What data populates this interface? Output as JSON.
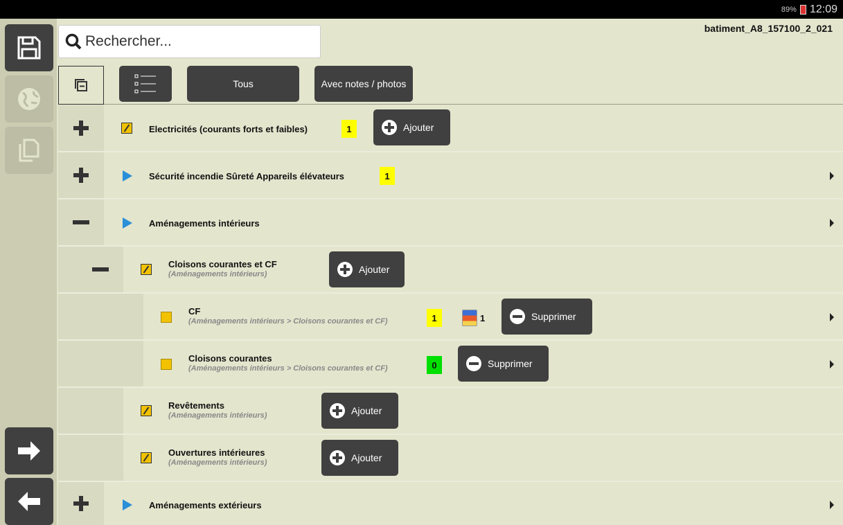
{
  "status": {
    "battery": "89%",
    "time": "12:09"
  },
  "file": {
    "name": "batiment_A8_157100_2_021"
  },
  "search": {
    "placeholder": "Rechercher..."
  },
  "toolbar": {
    "all_label": "Tous",
    "notes_label": "Avec notes / photos"
  },
  "rows": [
    {
      "label": "Electricités (courants forts et faibles)",
      "count": "1",
      "add": "Ajouter"
    },
    {
      "label": "Sécurité incendie Sûreté Appareils élévateurs",
      "count": "1"
    },
    {
      "label": "Aménagements intérieurs"
    },
    {
      "label": "Cloisons courantes et CF",
      "sub": "(Aménagements intérieurs)",
      "add": "Ajouter"
    },
    {
      "label": "CF",
      "sub": "(Aménagements intérieurs > Cloisons courantes et CF)",
      "count": "1",
      "photos": "1",
      "del": "Supprimer"
    },
    {
      "label": "Cloisons courantes",
      "sub": "(Aménagements intérieurs > Cloisons courantes et CF)",
      "count": "0",
      "del": "Supprimer"
    },
    {
      "label": "Revêtements",
      "sub": "(Aménagements intérieurs)",
      "add": "Ajouter"
    },
    {
      "label": "Ouvertures intérieures",
      "sub": "(Aménagements intérieurs)",
      "add": "Ajouter"
    },
    {
      "label": "Aménagements extérieurs"
    }
  ],
  "colors": {
    "accent_dark": "#404040",
    "badge_yellow": "#ffff00",
    "badge_green": "#00e000",
    "background": "#e3e5cd"
  }
}
